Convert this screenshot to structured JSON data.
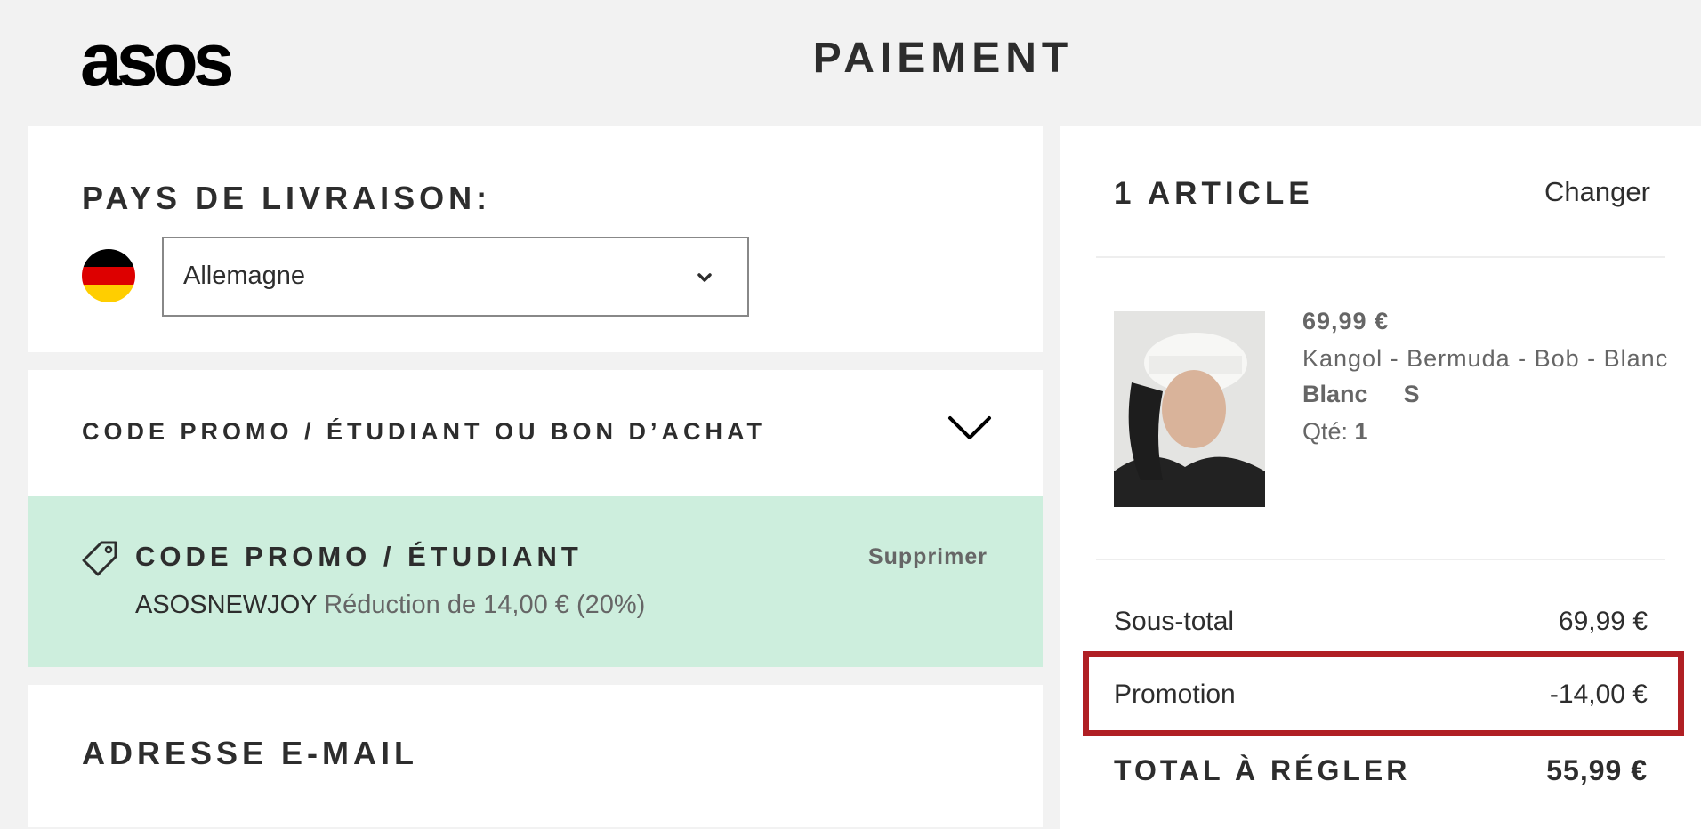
{
  "header": {
    "logo_text": "asos",
    "title": "PAIEMENT"
  },
  "shipping_country": {
    "heading": "PAYS DE LIVRAISON:",
    "flag_icon": "germany-flag-icon",
    "selected_country": "Allemagne",
    "chevron_icon": "chevron-down-icon"
  },
  "promo": {
    "heading": "CODE PROMO / ÉTUDIANT OU BON D’ACHAT",
    "toggle_icon": "chevron-down-icon",
    "applied": {
      "heading": "CODE PROMO / ÉTUDIANT",
      "icon": "tag-icon",
      "remove_label": "Supprimer",
      "code": "ASOSNEWJOY",
      "description": "Réduction de 14,00 € (20%)",
      "background_color": "#cdeedd"
    }
  },
  "email": {
    "heading": "ADRESSE E-MAIL"
  },
  "summary": {
    "count_label": "1 ARTICLE",
    "change_label": "Changer",
    "item": {
      "price": "69,99 €",
      "name": "Kangol - Bermuda - Bob - Blanc",
      "color": "Blanc",
      "size": "S",
      "qty_label": "Qté:",
      "qty_value": "1"
    },
    "subtotal_label": "Sous-total",
    "subtotal_value": "69,99 €",
    "promotion_label": "Promotion",
    "promotion_value": "-14,00 €",
    "total_label": "TOTAL À RÉGLER",
    "total_value": "55,99 €",
    "highlight_color": "#b01f24"
  }
}
